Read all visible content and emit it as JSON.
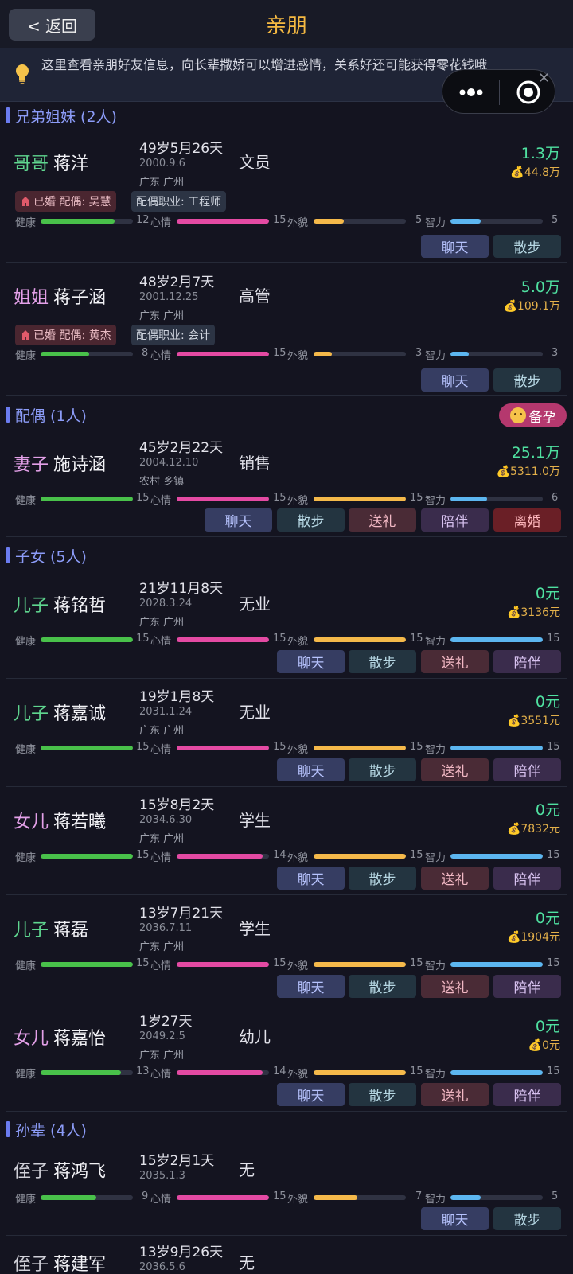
{
  "topbar": {
    "back_label": "< 返回",
    "title": "亲朋"
  },
  "notice": {
    "text": "这里查看亲朋好友信息，向长辈撒娇可以增进感情，关系好还可能获得零花钱哦",
    "icon": "lightbulb-icon"
  },
  "stat_labels": {
    "health": "健康",
    "mood": "心情",
    "look": "外貌",
    "iq": "智力"
  },
  "actions": {
    "chat": "聊天",
    "walk": "散步",
    "gift": "送礼",
    "accompany": "陪伴",
    "divorce": "离婚"
  },
  "colors": {
    "accent": "#f5b942",
    "section": "#8c9cf8",
    "income": "#4fe0a0",
    "savings": "#e3b04a",
    "health": "#49c14a",
    "mood": "#e44aa3",
    "look": "#f5b94a",
    "iq": "#5cb6f0"
  },
  "sections": {
    "siblings": {
      "title": "兄弟姐妹 (2人)"
    },
    "spouse": {
      "title": "配偶 (1人)",
      "badge": "备孕"
    },
    "children": {
      "title": "子女 (5人)"
    },
    "grandchildren": {
      "title": "孙辈 (4人)"
    }
  },
  "people": [
    {
      "relation": "哥哥",
      "name": "蒋洋",
      "age": "49岁5月26天",
      "birth": "2000.9.6",
      "place": "广东 广州",
      "job": "文员",
      "income": "1.3万",
      "savings": "💰44.8万",
      "married_tag": "已婚 配偶: 吴慧",
      "spouse_job_tag": "配偶职业: 工程师",
      "health": 12,
      "mood": 15,
      "look": 5,
      "iq": 5,
      "fills": {
        "health": 0.8,
        "mood": 1.0,
        "look": 0.33,
        "iq": 0.33
      }
    },
    {
      "relation": "姐姐",
      "name": "蒋子涵",
      "age": "48岁2月7天",
      "birth": "2001.12.25",
      "place": "广东 广州",
      "job": "高管",
      "income": "5.0万",
      "savings": "💰109.1万",
      "married_tag": "已婚 配偶: 黄杰",
      "spouse_job_tag": "配偶职业: 会计",
      "health": 8,
      "mood": 15,
      "look": 3,
      "iq": 3,
      "fills": {
        "health": 0.53,
        "mood": 1.0,
        "look": 0.2,
        "iq": 0.2
      }
    },
    {
      "relation": "妻子",
      "name": "施诗涵",
      "age": "45岁2月22天",
      "birth": "2004.12.10",
      "place": "农村 乡镇",
      "job": "销售",
      "income": "25.1万",
      "savings": "💰5311.0万",
      "health": 15,
      "mood": 15,
      "look": 15,
      "iq": 6,
      "fills": {
        "health": 1.0,
        "mood": 1.0,
        "look": 1.0,
        "iq": 0.4
      }
    },
    {
      "relation": "儿子",
      "name": "蒋铭哲",
      "age": "21岁11月8天",
      "birth": "2028.3.24",
      "place": "广东 广州",
      "job": "无业",
      "income": "0元",
      "savings": "💰3136元",
      "health": 15,
      "mood": 15,
      "look": 15,
      "iq": 15,
      "fills": {
        "health": 1.0,
        "mood": 1.0,
        "look": 1.0,
        "iq": 1.0
      }
    },
    {
      "relation": "儿子",
      "name": "蒋嘉诚",
      "age": "19岁1月8天",
      "birth": "2031.1.24",
      "place": "广东 广州",
      "job": "无业",
      "income": "0元",
      "savings": "💰3551元",
      "health": 15,
      "mood": 15,
      "look": 15,
      "iq": 15,
      "fills": {
        "health": 1.0,
        "mood": 1.0,
        "look": 1.0,
        "iq": 1.0
      }
    },
    {
      "relation": "女儿",
      "name": "蒋若曦",
      "age": "15岁8月2天",
      "birth": "2034.6.30",
      "place": "广东 广州",
      "job": "学生",
      "income": "0元",
      "savings": "💰7832元",
      "health": 15,
      "mood": 14,
      "look": 15,
      "iq": 15,
      "fills": {
        "health": 1.0,
        "mood": 0.93,
        "look": 1.0,
        "iq": 1.0
      }
    },
    {
      "relation": "儿子",
      "name": "蒋磊",
      "age": "13岁7月21天",
      "birth": "2036.7.11",
      "place": "广东 广州",
      "job": "学生",
      "income": "0元",
      "savings": "💰1904元",
      "health": 15,
      "mood": 15,
      "look": 15,
      "iq": 15,
      "fills": {
        "health": 1.0,
        "mood": 1.0,
        "look": 1.0,
        "iq": 1.0
      }
    },
    {
      "relation": "女儿",
      "name": "蒋嘉怡",
      "age": "1岁27天",
      "birth": "2049.2.5",
      "place": "广东 广州",
      "job": "幼儿",
      "income": "0元",
      "savings": "💰0元",
      "health": 13,
      "mood": 14,
      "look": 15,
      "iq": 15,
      "fills": {
        "health": 0.87,
        "mood": 0.93,
        "look": 1.0,
        "iq": 1.0
      }
    },
    {
      "relation": "侄子",
      "name": "蒋鸿飞",
      "age": "15岁2月1天",
      "birth": "2035.1.3",
      "place": "",
      "job": "无",
      "health": 9,
      "mood": 15,
      "look": 7,
      "iq": 5,
      "fills": {
        "health": 0.6,
        "mood": 1.0,
        "look": 0.47,
        "iq": 0.33
      }
    },
    {
      "relation": "侄子",
      "name": "蒋建军",
      "age": "13岁9月26天",
      "birth": "2036.5.6",
      "place": "",
      "job": "无"
    }
  ]
}
